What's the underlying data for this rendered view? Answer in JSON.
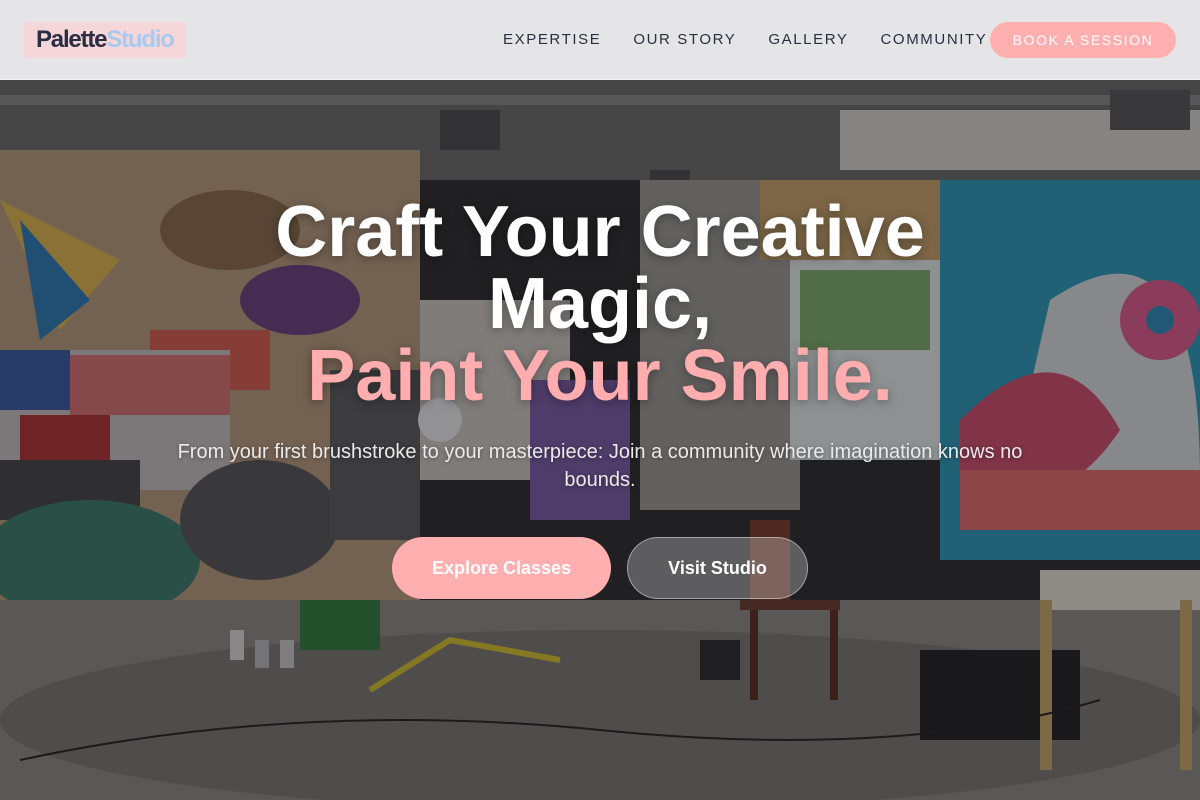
{
  "header": {
    "logo": {
      "part1": "Palette",
      "part2": "Studio"
    },
    "nav": [
      {
        "label": "EXPERTISE"
      },
      {
        "label": "OUR STORY"
      },
      {
        "label": "GALLERY"
      },
      {
        "label": "COMMUNITY"
      }
    ],
    "cta_label": "BOOK A SESSION"
  },
  "hero": {
    "headline_line1": "Craft Your Creative",
    "headline_line2": "Magic,",
    "headline_accent": "Paint Your Smile.",
    "subtitle": "From your first brushstroke to your masterpiece: Join a community where imagination knows no bounds.",
    "primary_button": "Explore Classes",
    "secondary_button": "Visit Studio"
  },
  "colors": {
    "accent_pink": "#ffafb0",
    "logo_blue": "#a9c9f0",
    "text_dark": "#2b2d42"
  }
}
